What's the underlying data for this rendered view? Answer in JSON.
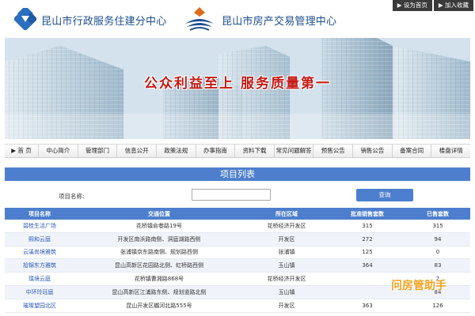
{
  "header": {
    "center_title": "昆山市行政服务住建分中心",
    "housing_title": "昆山市房产交易管理中心",
    "top_links": [
      "▶ 设为首页",
      "▶ 加入收藏"
    ]
  },
  "banner": {
    "slogan": "公众利益至上 服务质量第一"
  },
  "nav": {
    "items": [
      "▶ 首 页",
      "中心简介",
      "管理部门",
      "信息公开",
      "政策法规",
      "办事指南",
      "资料下载",
      "常见问题解答",
      "预售公告",
      "销售公告",
      "备案合同",
      "楼盘详情"
    ]
  },
  "project_list": {
    "title": "项目列表",
    "search_label": "项目名称:",
    "search_value": "",
    "query_button": "查询",
    "columns": [
      "项目名称",
      "交通位置",
      "所在区域",
      "批准销售套数",
      "已售套数"
    ],
    "rows": [
      [
        "碧桂生活广场",
        "花桥镇俞巷路19号",
        "花桥经济开发区",
        "315",
        "315"
      ],
      [
        "熙和云庭",
        "开发区南浜路南侧、洞庭湖路西侧",
        "开发区",
        "272",
        "94"
      ],
      [
        "云溪尚境雅筑",
        "张浦镇京东路南侧、规划路西侧",
        "张浦镇",
        "125",
        "0"
      ],
      [
        "拾锦东方雅筑",
        "昆山高新区花园路北侧、虹桥路西侧",
        "玉山镇",
        "364",
        "83"
      ],
      [
        "璞境云庭",
        "花桥镇曹湘路868号",
        "花桥经济开发区",
        "",
        "2"
      ],
      [
        "中环玲珏庭",
        "昆山高新区江浦路东侧、规划道路北侧",
        "玉山镇",
        "",
        "84"
      ],
      [
        "璀璨望园北区",
        "昆山开发区樾河北路555号",
        "开发区",
        "363",
        "126"
      ]
    ]
  },
  "watermark": "问房管助手",
  "colors": {
    "accent": "#4e7fce",
    "title_blue": "#1d4e8f",
    "slogan_red": "#c41a14",
    "link_blue": "#2856b8"
  }
}
